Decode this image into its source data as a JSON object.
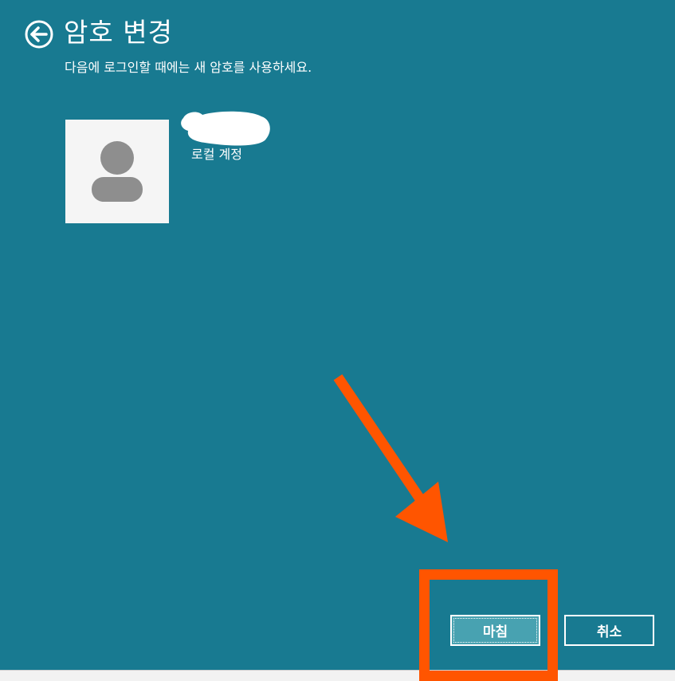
{
  "window": {
    "title": "암호 변경",
    "subtitle": "다음에 로그인할 때에는 새 암호를 사용하세요.",
    "background_color": "#187a91"
  },
  "header": {
    "back_icon": "back-arrow-circle-icon"
  },
  "account": {
    "avatar_icon": "user-silhouette-icon",
    "type_label": "로컬 계정"
  },
  "buttons": {
    "finish_label": "마침",
    "cancel_label": "취소"
  },
  "annotation": {
    "color": "#ff5500"
  }
}
